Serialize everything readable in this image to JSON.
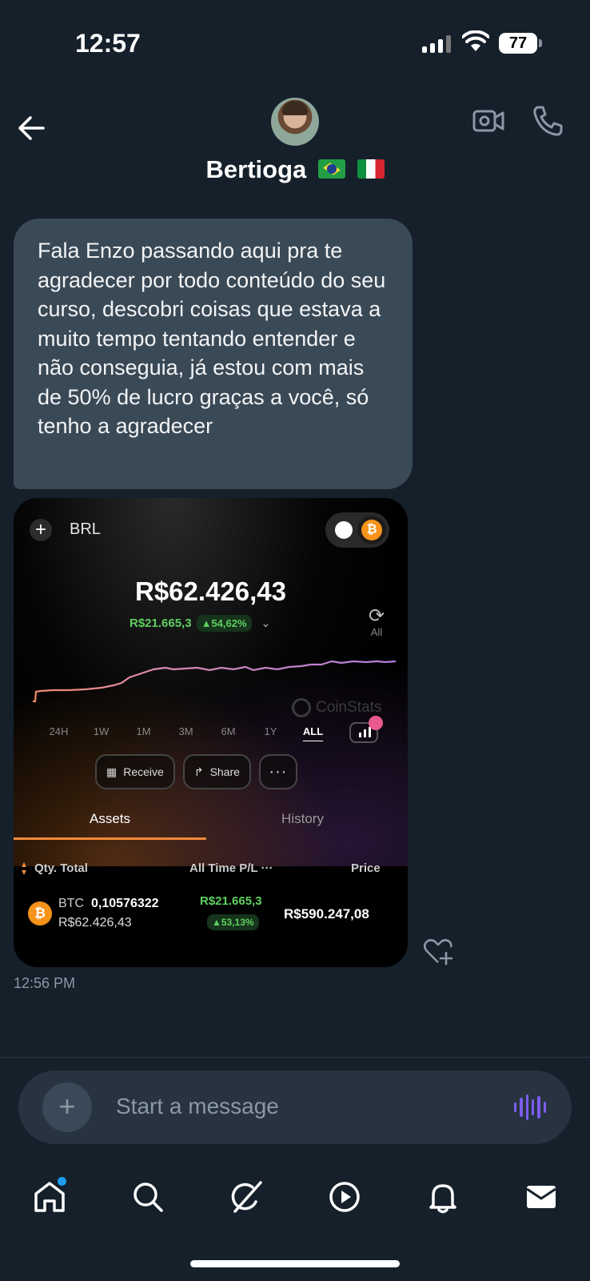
{
  "status_bar": {
    "time": "12:57",
    "battery": "77"
  },
  "header": {
    "contact_name": "Bertioga",
    "flags": [
      "brazil-flag",
      "italy-flag"
    ]
  },
  "message": {
    "text": "Fala Enzo passando aqui pra te agradecer por todo conteúdo do seu curso, descobri coisas que estava a muito tempo tentando entender e não conseguia, já estou com mais de 50% de lucro graças a você, só tenho a agradecer",
    "timestamp": "12:56 PM"
  },
  "screenshot_card": {
    "currency": "BRL",
    "balance": "R$62.426,43",
    "pl_value": "R$21.665,3",
    "pl_percent": "▲54,62%",
    "refresh_label": "All",
    "watermark": "CoinStats",
    "time_ranges": [
      "24H",
      "1W",
      "1M",
      "3M",
      "6M",
      "1Y",
      "ALL"
    ],
    "active_range": "ALL",
    "actions": {
      "receive": "Receive",
      "share": "Share",
      "more": "···"
    },
    "tabs": {
      "assets": "Assets",
      "history": "History"
    },
    "table_header": {
      "qty_total": "Qty. Total",
      "pl": "All Time P/L ···",
      "price": "Price"
    },
    "asset": {
      "symbol": "BTC",
      "quantity": "0,10576322",
      "total": "R$62.426,43",
      "pl_value": "R$21.665,3",
      "pl_percent": "▲53,13%",
      "price": "R$590.247,08"
    },
    "icon_colors": {
      "bitcoin": "#f7931a",
      "gain": "#5fcf5f",
      "accent": "#f08a3c"
    }
  },
  "composer": {
    "placeholder": "Start a message"
  },
  "bottom_nav": [
    "home-icon",
    "search-icon",
    "grok-icon",
    "video-icon",
    "notifications-icon",
    "messages-icon"
  ],
  "colors": {
    "background": "#15202b",
    "bubble": "#3a4956",
    "accent_blue": "#1d9bf0",
    "voice": "#7b5cf0"
  }
}
